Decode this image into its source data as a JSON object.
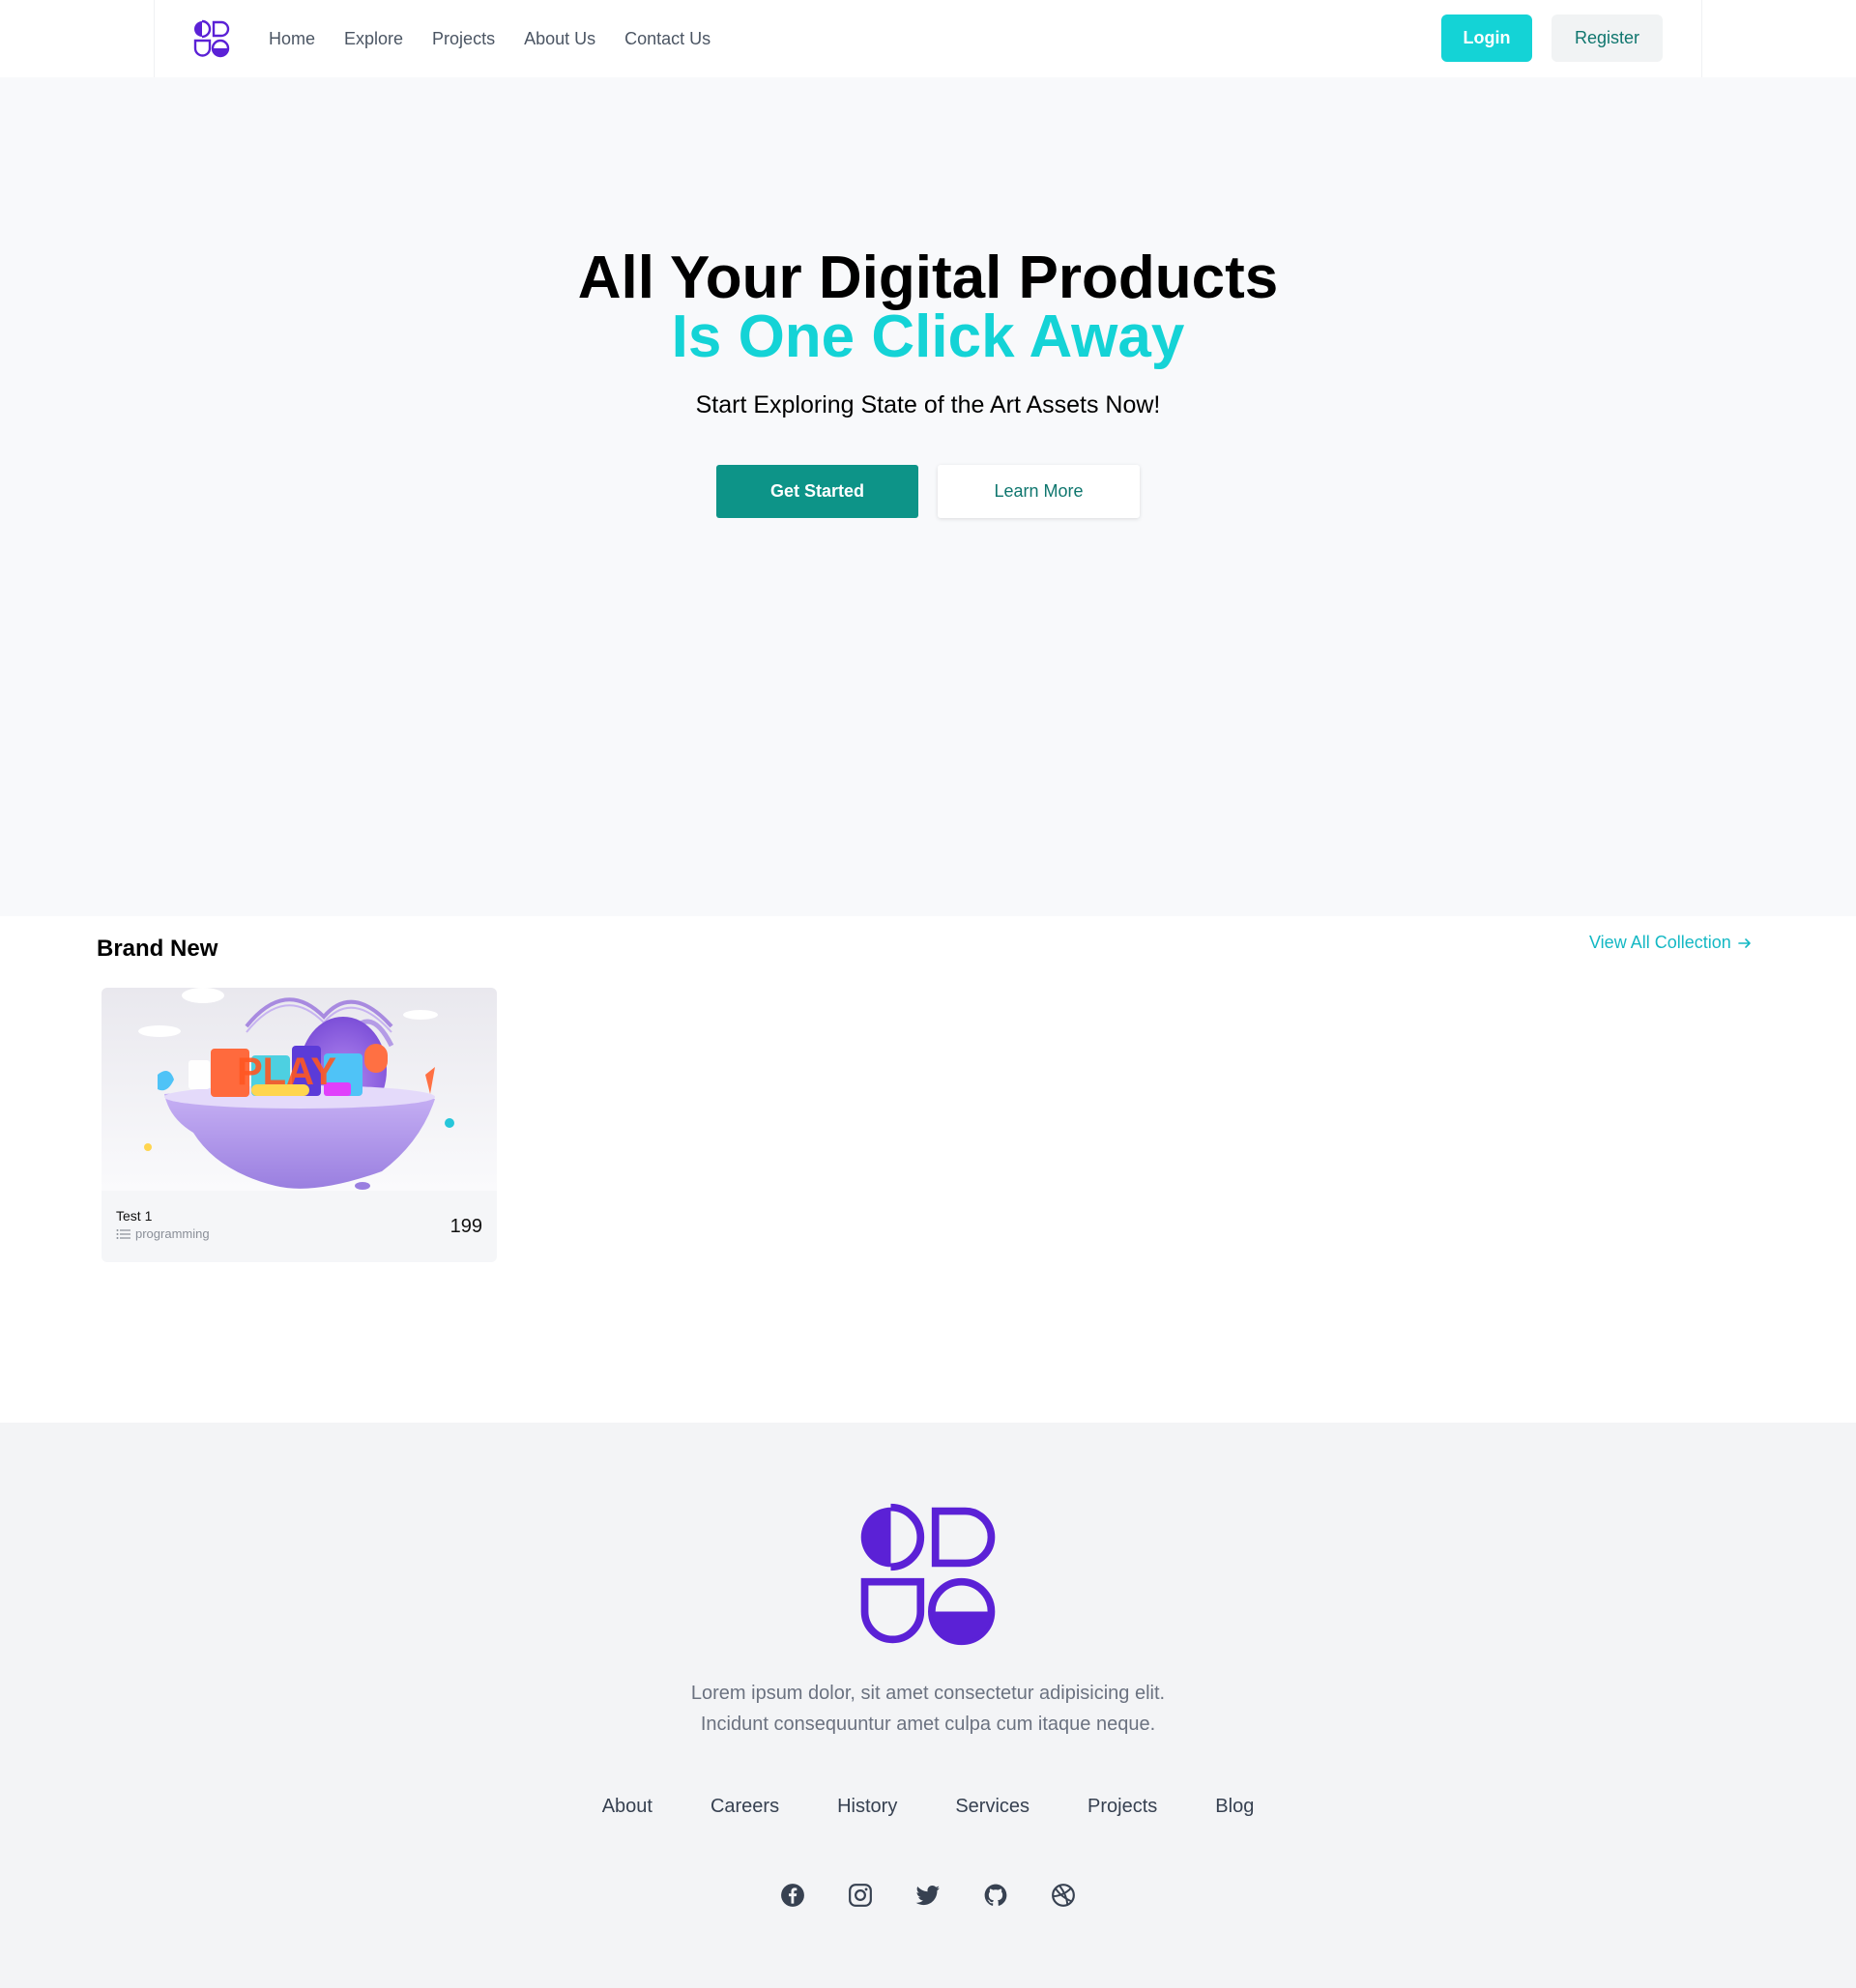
{
  "colors": {
    "brand_purple": "#5b21d6",
    "accent_cyan": "#14d3d6",
    "accent_teal": "#0d9488"
  },
  "nav": {
    "links": [
      "Home",
      "Explore",
      "Projects",
      "About Us",
      "Contact Us"
    ],
    "login_label": "Login",
    "register_label": "Register"
  },
  "hero": {
    "title_line1": "All Your Digital Products",
    "title_line2": "Is One Click Away",
    "subtitle": "Start Exploring State of the Art Assets Now!",
    "primary_button": "Get Started",
    "secondary_button": "Learn More"
  },
  "brand_new": {
    "title": "Brand New",
    "view_all_label": "View All Collection",
    "products": [
      {
        "name": "Test 1",
        "category": "programming",
        "price": "199",
        "image_text": "PLAY"
      }
    ]
  },
  "footer": {
    "text_line1": "Lorem ipsum dolor, sit amet consectetur adipisicing elit.",
    "text_line2": "Incidunt consequuntur amet culpa cum itaque neque.",
    "links": [
      "About",
      "Careers",
      "History",
      "Services",
      "Projects",
      "Blog"
    ],
    "socials": [
      "facebook-icon",
      "instagram-icon",
      "twitter-icon",
      "github-icon",
      "dribbble-icon"
    ]
  }
}
